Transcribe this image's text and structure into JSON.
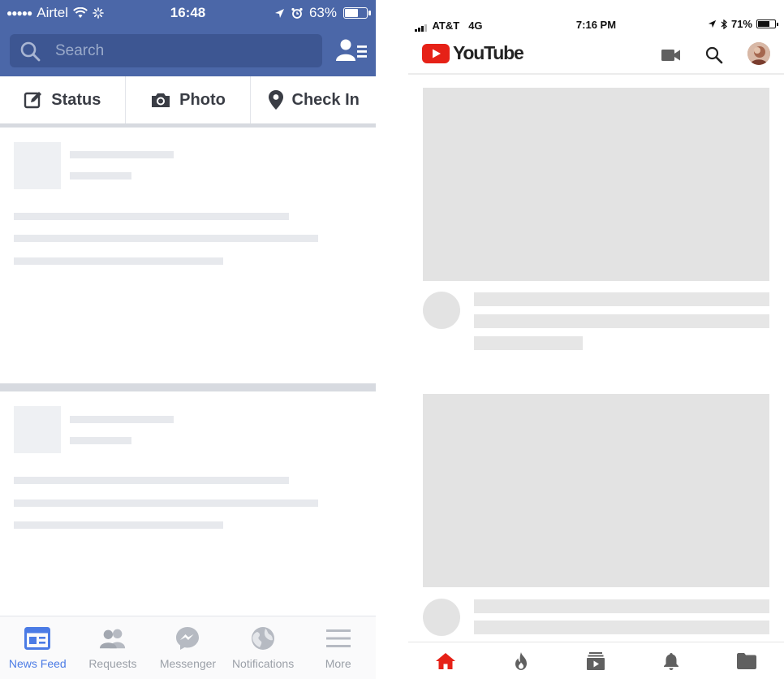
{
  "facebook": {
    "status_bar": {
      "signal_dots": "●●●●●",
      "carrier": "Airtel",
      "time": "16:48",
      "battery": "63%",
      "battery_level": 0.63
    },
    "search": {
      "placeholder": "Search"
    },
    "actions": [
      {
        "label": "Status",
        "icon": "edit-icon"
      },
      {
        "label": "Photo",
        "icon": "camera-icon"
      },
      {
        "label": "Check In",
        "icon": "location-pin-icon"
      }
    ],
    "tabbar": [
      {
        "label": "News Feed",
        "icon": "news-feed-icon",
        "active": true
      },
      {
        "label": "Requests",
        "icon": "friends-icon",
        "active": false
      },
      {
        "label": "Messenger",
        "icon": "messenger-icon",
        "active": false
      },
      {
        "label": "Notifications",
        "icon": "globe-icon",
        "active": false
      },
      {
        "label": "More",
        "icon": "menu-icon",
        "active": false
      }
    ],
    "colors": {
      "brand": "#4b67a8",
      "active_tab": "#4b7be5"
    }
  },
  "youtube": {
    "status_bar": {
      "carrier": "AT&T",
      "network": "4G",
      "time": "7:16 PM",
      "battery": "71%",
      "battery_level": 0.71
    },
    "logo_text": "YouTube",
    "header_icons": [
      "video-camera-icon",
      "search-icon",
      "avatar"
    ],
    "tabbar": [
      {
        "icon": "home-icon",
        "active": true
      },
      {
        "icon": "trending-flame-icon",
        "active": false
      },
      {
        "icon": "subscriptions-icon",
        "active": false
      },
      {
        "icon": "bell-icon",
        "active": false
      },
      {
        "icon": "library-folder-icon",
        "active": false
      }
    ],
    "colors": {
      "brand_red": "#e62117",
      "inactive_icon": "#606060"
    }
  }
}
